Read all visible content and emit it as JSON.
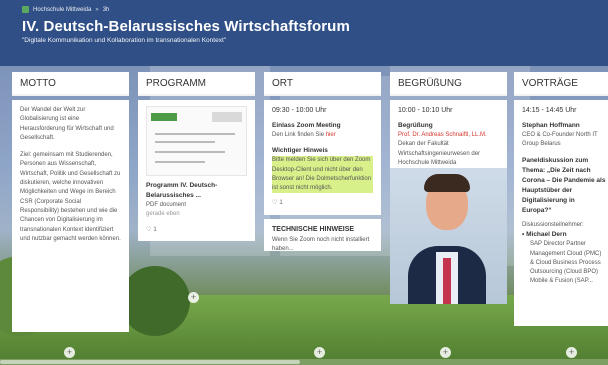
{
  "header": {
    "breadcrumb": [
      "Hochschule Mittweida",
      "»",
      "3h"
    ],
    "title": "IV. Deutsch-Belarussisches Wirtschaftsforum",
    "subtitle": "\"Digitale Kommunikation und Kollaboration im transnationalen Kontext\""
  },
  "colors": {
    "header_bg": "#2f4f86",
    "highlight": "#d7f08a",
    "red_text": "#d0342c"
  },
  "columns": {
    "motto": {
      "title": "MOTTO",
      "text1": "Der Wandel der Welt zur Globalisierung ist eine Herausforderung für Wirtschaft und Gesellschaft.",
      "text2": "Ziel: gemeinsam mit Studierenden, Personen aus Wissenschaft, Wirtschaft, Politik und Gesellschaft zu diskutieren, welche innovativen Möglichkeiten und Wege im Bereich CSR (Corporate Social Responsibility) bestehen und wie die Chancen von Digitalisierung im transnationalen Kontext identifiziert und nutzbar gemacht werden können."
    },
    "programm": {
      "title": "PROGRAMM",
      "doc_title": "Programm IV. Deutsch-Belarussisches ...",
      "doc_type": "PDF document",
      "doc_meta": "gerade eben",
      "likes": "1"
    },
    "ort": {
      "title": "ORT",
      "time": "09:30 - 10:00 Uhr",
      "event": "Einlass Zoom Meeting",
      "link_text": "Den Link finden Sie ",
      "link_red": "hier",
      "hint_title": "Wichtiger Hinweis",
      "hint_text": "Bitte melden Sie sich über den Zoom Desktop-Client und nicht über den Browser an! Die Dolmetscherfunktion ist sonst nicht möglich.",
      "likes": "1",
      "card2_title": "TECHNISCHE HINWEISE",
      "card2_text": "Wenn Sie Zoom noch nicht installiert haben..."
    },
    "begruessung": {
      "title": "BEGRÜßUNG",
      "time": "10:00 - 10:10 Uhr",
      "event": "Begrüßung",
      "speaker": "Prof. Dr. Andreas Schnaiftl, LL.M.",
      "role": "Dekan der Fakultät Wirtschaftsingenieurwesen der Hochschule Mittweida"
    },
    "vortraege": {
      "title": "VORTRÄGE",
      "time": "14:15 - 14:45 Uhr",
      "speaker": "Stephan Hoffmann",
      "role": "CEO & Co-Founder North IT Group Belarus",
      "panel_title": "Paneldiskussion zum Thema: „Die Zeit nach Corona – Die Pandemie als Hauptstüber der Digitalisierung in Europa?“",
      "participants_label": "Diskussionsteilnehmer:",
      "participant": "Michael Dern",
      "participant_role": "SAP Director Partner Management Cloud (PMC) & Cloud Business Process Outsourcing (Cloud BPO) Mobile & Fusion (SAP..."
    }
  }
}
